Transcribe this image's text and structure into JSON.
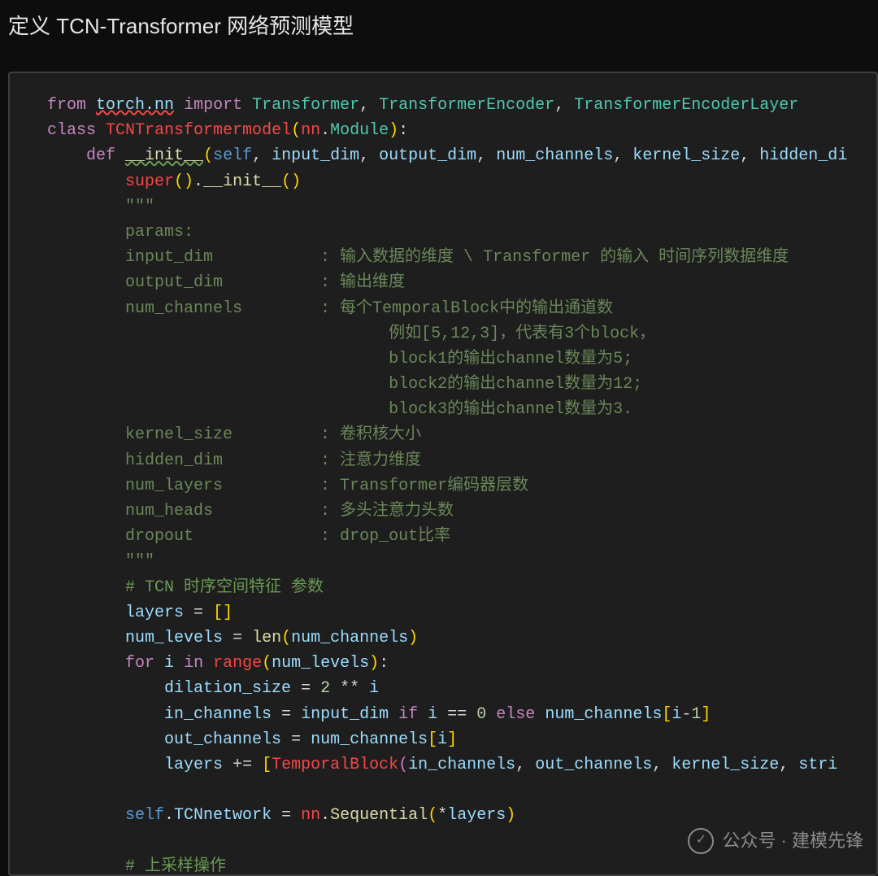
{
  "heading": "定义 TCN-Transformer 网络预测模型",
  "code": {
    "line1": {
      "from": "from",
      "mod": "torch.nn",
      "import": "import",
      "t": "Transformer",
      "te": "TransformerEncoder",
      "tel": "TransformerEncoderLayer"
    },
    "line2": {
      "class": "class",
      "name": "TCNTransformermodel",
      "nn": "nn",
      "Module": "Module"
    },
    "line3": {
      "def": "def",
      "init": "__init__",
      "self": "self",
      "p1": "input_dim",
      "p2": "output_dim",
      "p3": "num_channels",
      "p4": "kernel_size",
      "p5": "hidden_di"
    },
    "line4": {
      "super": "super",
      "init": "__init__"
    },
    "doc_open": "\"\"\"",
    "d_params": "params:",
    "d_input": "input_dim           : 输入数据的维度 \\ Transformer 的输入 时间序列数据维度",
    "d_output": "output_dim          : 输出维度",
    "d_numc": "num_channels        : 每个TemporalBlock中的输出通道数",
    "d_ex1": "                           例如[5,12,3]，代表有3个block，",
    "d_ex2": "                           block1的输出channel数量为5;",
    "d_ex3": "                           block2的输出channel数量为12;",
    "d_ex4": "                           block3的输出channel数量为3.",
    "d_kernel": "kernel_size         : 卷积核大小",
    "d_hidden": "hidden_dim          : 注意力维度",
    "d_layers": "num_layers          : Transformer编码器层数",
    "d_heads": "num_heads           : 多头注意力头数",
    "d_drop": "dropout             : drop_out比率",
    "doc_close": "\"\"\"",
    "c_tcn": "# TCN 时序空间特征 参数",
    "l_layers": {
      "layers": "layers"
    },
    "l_numlev": {
      "num_levels": "num_levels",
      "len": "len",
      "nc": "num_channels"
    },
    "l_for": {
      "for": "for",
      "i": "i",
      "in": "in",
      "range": "range",
      "nl": "num_levels"
    },
    "l_dil": {
      "ds": "dilation_size",
      "two": "2",
      "i": "i"
    },
    "l_inch": {
      "ic": "in_channels",
      "idim": "input_dim",
      "if": "if",
      "i": "i",
      "zero": "0",
      "else": "else",
      "nc": "num_channels",
      "one": "1"
    },
    "l_outch": {
      "oc": "out_channels",
      "nc": "num_channels",
      "i": "i"
    },
    "l_lay": {
      "layers": "layers",
      "tb": "TemporalBlock",
      "ic": "in_channels",
      "oc": "out_channels",
      "ks": "kernel_size",
      "st": "stri"
    },
    "l_self": {
      "self": "self",
      "tcnn": "TCNnetwork",
      "nn": "nn",
      "seq": "Sequential",
      "layers": "layers"
    },
    "c_up": "# 上采样操作"
  },
  "watermark": {
    "label": "公众号 · 建模先锋",
    "icon": "wechat-icon"
  }
}
